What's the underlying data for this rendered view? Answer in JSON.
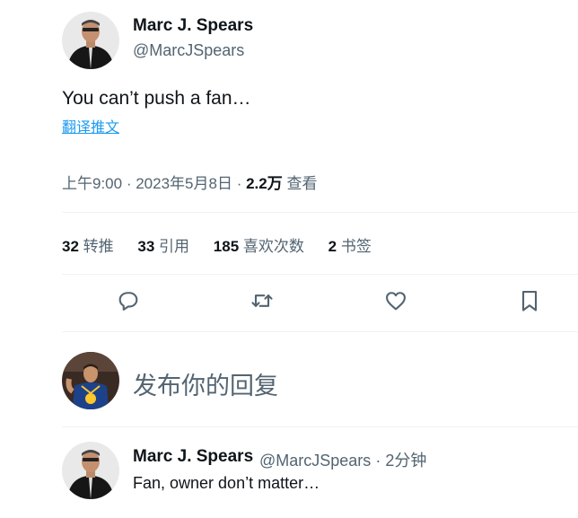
{
  "tweet": {
    "author_name": "Marc J. Spears",
    "author_handle": "@MarcJSpears",
    "text": "You can’t push a fan…",
    "translate_label": "翻译推文",
    "time": "上午9:00",
    "date": "2023年5月8日",
    "views_count": "2.2万",
    "views_label": "查看",
    "stats": [
      {
        "count": "32",
        "label": "转推"
      },
      {
        "count": "33",
        "label": "引用"
      },
      {
        "count": "185",
        "label": "喜欢次数"
      },
      {
        "count": "2",
        "label": "书签"
      }
    ],
    "actions": [
      "reply-icon",
      "retweet-icon",
      "like-icon",
      "bookmark-icon"
    ]
  },
  "reply_box": {
    "placeholder": "发布你的回复"
  },
  "reply_tweet": {
    "author_name": "Marc J. Spears",
    "author_handle": "@MarcJSpears",
    "time_ago": "2分钟",
    "text": "Fan, owner don’t matter…"
  },
  "colors": {
    "text_primary": "#0f1419",
    "text_secondary": "#536471",
    "link": "#1d9bf0",
    "divider": "#eff3f4"
  }
}
